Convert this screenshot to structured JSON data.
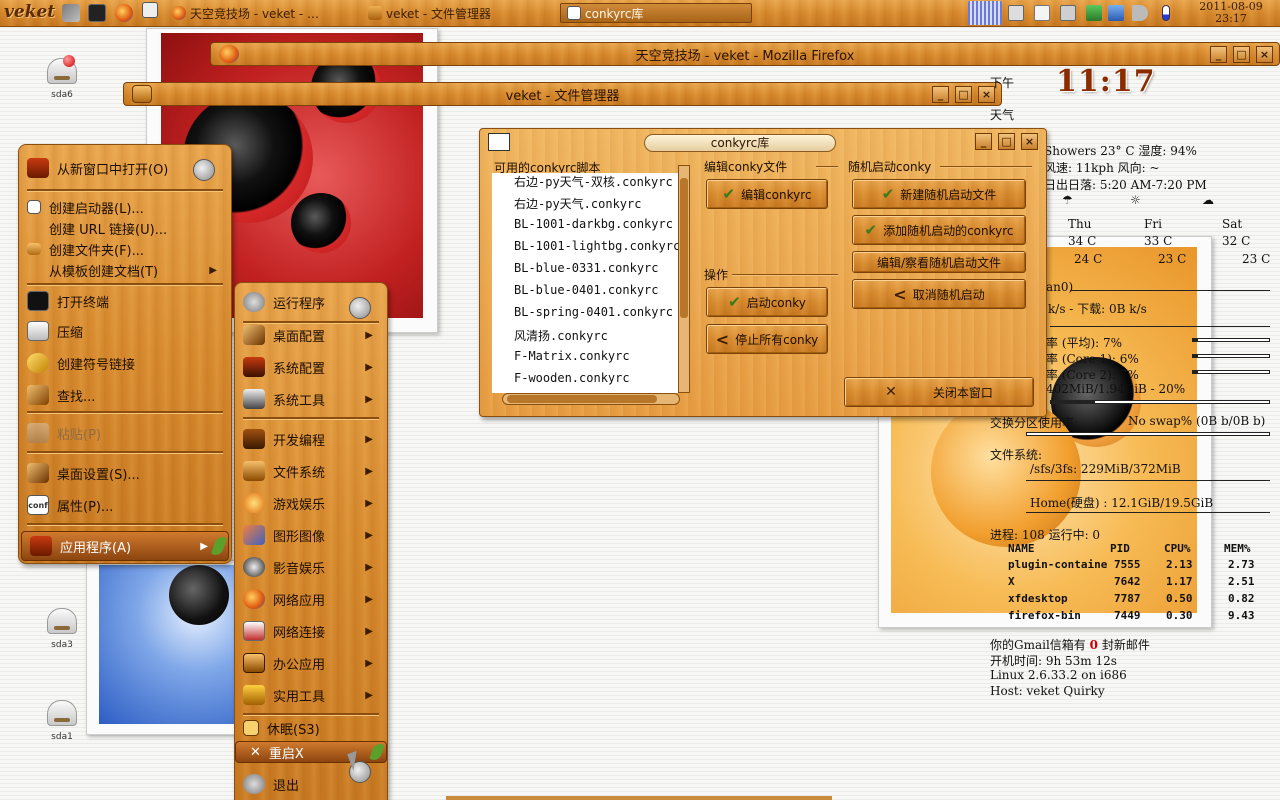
{
  "taskbar": {
    "logo": "veket",
    "tasks": [
      {
        "label": "天空竞技场 - veket - …",
        "active": false
      },
      {
        "label": "veket - 文件管理器",
        "active": false
      },
      {
        "label": "conkyrc库",
        "active": true
      }
    ],
    "clock_date": "2011-08-09",
    "clock_time": "23:17"
  },
  "desktop_icons": [
    {
      "label": "sda6"
    },
    {
      "label": "sda3"
    },
    {
      "label": "sda1"
    }
  ],
  "windows": {
    "firefox": {
      "title": "天空竞技场 - veket - Mozilla Firefox"
    },
    "file_manager": {
      "title": "veket - 文件管理器"
    }
  },
  "conky_dialog": {
    "title": "conkyrc库",
    "scripts_header": "可用的conkyrc脚本",
    "scripts": [
      "右边-py天气-双核.conkyrc",
      "右边-py天气.conkyrc",
      "BL-1001-darkbg.conkyrc",
      "BL-1001-lightbg.conkyrc",
      "BL-blue-0331.conkyrc",
      "BL-blue-0401.conkyrc",
      "BL-spring-0401.conkyrc",
      "风清扬.conkyrc",
      "F-Matrix.conkyrc",
      "F-wooden.conkyrc"
    ],
    "edit_group": "编辑conky文件",
    "edit_button": "编辑conkyrc",
    "ops_group": "操作",
    "start_button": "启动conky",
    "stop_button": "停止所有conky",
    "autostart_group": "随机启动conky",
    "new_autostart_button": "新建随机启动文件",
    "add_autostart_button": "添加随机启动的conkyrc",
    "view_autostart_button": "编辑/察看随机启动文件",
    "cancel_autostart_button": "取消随机启动",
    "close_button": "关闭本窗口"
  },
  "desktop_menu": {
    "items": [
      {
        "label": "从新窗口中打开(O)",
        "submenu": false,
        "disabled": false
      },
      {
        "label": "创建启动器(L)...",
        "submenu": false,
        "disabled": false
      },
      {
        "label": "创建 URL 链接(U)...",
        "submenu": false,
        "disabled": false
      },
      {
        "label": "创建文件夹(F)...",
        "submenu": false,
        "disabled": false
      },
      {
        "label": "从模板创建文档(T)",
        "submenu": true,
        "disabled": false
      },
      {
        "label": "打开终端",
        "submenu": false,
        "disabled": false
      },
      {
        "label": "压缩",
        "submenu": false,
        "disabled": false
      },
      {
        "label": "创建符号链接",
        "submenu": false,
        "disabled": false
      },
      {
        "label": "查找...",
        "submenu": false,
        "disabled": false
      },
      {
        "label": "粘贴(P)",
        "submenu": false,
        "disabled": true
      },
      {
        "label": "桌面设置(S)...",
        "submenu": false,
        "disabled": false
      },
      {
        "label": "属性(P)...",
        "submenu": false,
        "disabled": false
      },
      {
        "label": "应用程序(A)",
        "submenu": true,
        "disabled": false
      }
    ]
  },
  "apps_menu": {
    "items": [
      {
        "label": "运行程序",
        "submenu": false
      },
      {
        "label": "桌面配置",
        "submenu": true
      },
      {
        "label": "系统配置",
        "submenu": true
      },
      {
        "label": "系统工具",
        "submenu": true
      },
      {
        "label": "开发编程",
        "submenu": true
      },
      {
        "label": "文件系统",
        "submenu": true
      },
      {
        "label": "游戏娱乐",
        "submenu": true
      },
      {
        "label": "图形图像",
        "submenu": true
      },
      {
        "label": "影音娱乐",
        "submenu": true
      },
      {
        "label": "网络应用",
        "submenu": true
      },
      {
        "label": "网络连接",
        "submenu": true
      },
      {
        "label": "办公应用",
        "submenu": true
      },
      {
        "label": "实用工具",
        "submenu": true
      },
      {
        "label": "休眠(S3)",
        "submenu": false
      },
      {
        "label": "重启X",
        "submenu": false
      },
      {
        "label": "退出",
        "submenu": false
      }
    ]
  },
  "conky": {
    "bigclock": "11:17",
    "afternoon": "下午",
    "weather_label": "天气",
    "weather_line": "Showers  23° C 湿度: 94%",
    "wind_line": "风速: 11kph 风向: ~",
    "sun_line": "日出日落: 5:20 AM-7:20 PM",
    "forecast": [
      {
        "day": "Thu",
        "hi": "34 C",
        "lo": "24 C"
      },
      {
        "day": "Fri",
        "hi": "33 C",
        "lo": "23 C"
      },
      {
        "day": "Sat",
        "hi": "32 C",
        "lo": "23 C"
      }
    ],
    "net_iface": "an0)",
    "net_line": "k/s - 下载: 0B  k/s",
    "cpu_avg": "率 (平均): 7%",
    "cpu_core1": "率 (Core 1): 6%",
    "cpu_core2": "率 (Core 2): 7%",
    "mem_line": "402MiB/1.94GiB - 20%",
    "swap_label": "交换分区使用率:",
    "swap_value": "No swap% (0B  b/0B  b)",
    "fs_label": "文件系统:",
    "fs_root": "/sfs/3fs: 229MiB/372MiB",
    "fs_home": "Home(硬盘) :  12.1GiB/19.5GiB",
    "proc_line": "进程: 108    运行中: 0",
    "table_headers": [
      "NAME",
      "PID",
      "CPU%",
      "MEM%"
    ],
    "table_rows": [
      [
        "plugin-containe",
        "7555",
        "2.13",
        "2.73"
      ],
      [
        "X",
        "7642",
        "1.17",
        "2.51"
      ],
      [
        "xfdesktop",
        "7787",
        "0.50",
        "0.82"
      ],
      [
        "firefox-bin",
        "7449",
        "0.30",
        "9.43"
      ]
    ],
    "gmail_prefix": "你的Gmail信箱有",
    "gmail_count": "0",
    "gmail_suffix": "封新邮件",
    "uptime": "开机时间:    9h 53m 12s",
    "kernel": "Linux 2.6.33.2 on i686",
    "host": "Host:  veket Quirky",
    "cpu_avg_pct": 7,
    "cpu_core1_pct": 6,
    "cpu_core2_pct": 7,
    "mem_pct": 20
  }
}
